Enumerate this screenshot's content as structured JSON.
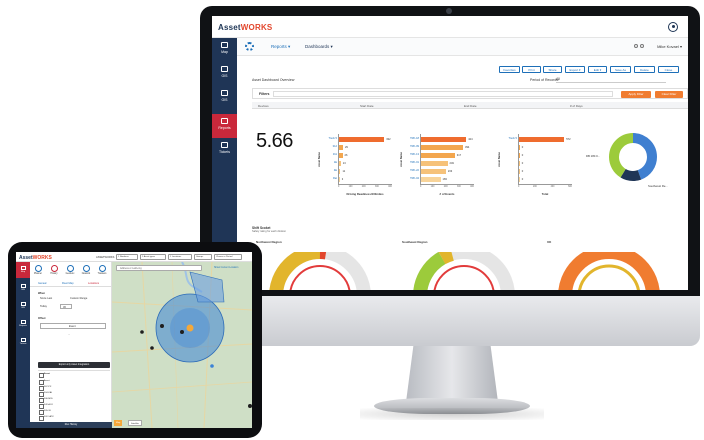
{
  "imac": {
    "logo": {
      "part1": "Asset",
      "part2": "WORKS"
    },
    "sidebar": [
      {
        "label": "Map",
        "active": false
      },
      {
        "label": "GIS",
        "active": false
      },
      {
        "label": "GIS",
        "active": false
      },
      {
        "label": "Reports",
        "active": true
      },
      {
        "label": "Tickets",
        "active": false
      }
    ],
    "subheader": {
      "reports_tab": "Reports ▾",
      "dashboards_tab": "Dashboards ▾",
      "user_name": "Mike Kovael ▾"
    },
    "toolbar_buttons": [
      "Favorites",
      "Print",
      "Share",
      "Export ▾",
      "Edit ▾",
      "Save As",
      "Delete",
      "Close"
    ],
    "report": {
      "title": "Asset Dashboard Overview",
      "period_label": "Period of Records:",
      "period_value": "All",
      "filters_label": "Filters",
      "apply_filter": "Apply Filter",
      "clear_filter": "Clear Filter",
      "columns": [
        "Devices",
        "Start Date",
        "End Date",
        "# of Days"
      ],
      "kpi_value": "5.66"
    },
    "charts": [
      {
        "type": "bar",
        "xlabel": "Driving Readiness/100miles",
        "ylabel": "Asset Name",
        "ticks": [
          "0",
          "100",
          "200",
          "300",
          "400"
        ],
        "categories": [
          "Truck 5",
          "312",
          "311",
          "1E",
          "4E",
          "Ret"
        ],
        "values": [
          332,
          29,
          26,
          13,
          11,
          3
        ]
      },
      {
        "type": "bar",
        "xlabel": "# of Events",
        "ylabel": "Asset Name",
        "ticks": [
          "0",
          "100",
          "200",
          "300",
          "400"
        ],
        "categories": [
          "TRK-18",
          "TRK-09",
          "TRK-13",
          "TRK-01",
          "TRK-22",
          "TRK-04"
        ],
        "values": [
          424,
          394,
          317,
          249,
          233,
          183
        ]
      },
      {
        "type": "bar",
        "xlabel": "Total",
        "ylabel": "Asset Name",
        "ticks": [
          "0",
          "200",
          "400",
          "600"
        ],
        "categories": [
          "Truck 5",
          "",
          "",
          "",
          "",
          ""
        ],
        "values": [
          572,
          0,
          0,
          0,
          0,
          0
        ]
      }
    ],
    "donut": {
      "labels": [
        "DB 180.0...",
        "Southwest Re..."
      ]
    },
    "section": {
      "title": "Shift Scoket",
      "subtitle": "Safety rating for each division",
      "gauges": [
        "Northwest Region",
        "Southeast Region",
        "UK"
      ]
    },
    "colors": {
      "navy": "#1f3556",
      "red": "#c9283b",
      "orange": "#f07c30",
      "blue": "#1d6fb8"
    }
  },
  "tablet": {
    "logo": {
      "part1": "Asset",
      "part2": "WORKS"
    },
    "fleet_label": "ASSETWORKS",
    "chips": [
      "1 Numbers",
      "1 Asset types",
      "1 Locations",
      "Groups",
      "Choose a Period"
    ],
    "sidebar": [
      "Map",
      "GIS",
      "GIS",
      "Reports",
      "Tickets"
    ],
    "tools": [
      "Planner",
      "History",
      "Geofenc",
      "Network",
      "Trackers"
    ],
    "subtabs": [
      "Geneal",
      "Fleet Map",
      "Locations"
    ],
    "when_label": "When",
    "opt_last": "Since Last",
    "opt_custom": "Custom Range",
    "today": "Today",
    "today_num": "30",
    "offset_label": "Offset",
    "offset_value": "Event",
    "export_btn": "Export only Asset Integration",
    "assets_header": "Asset",
    "assets": [
      "Asset",
      "367-PX",
      "304-KAI",
      "306-M55",
      "342-ACO",
      "305-1K",
      "302-1ATK"
    ],
    "footer_note": "Selected for Ant",
    "bottom_bar": "Run Histroy",
    "search_placeholder": "Address or Lat/Long",
    "zone_label": "Show Current Location",
    "map_buttons": [
      "Map",
      "Satellite"
    ]
  }
}
